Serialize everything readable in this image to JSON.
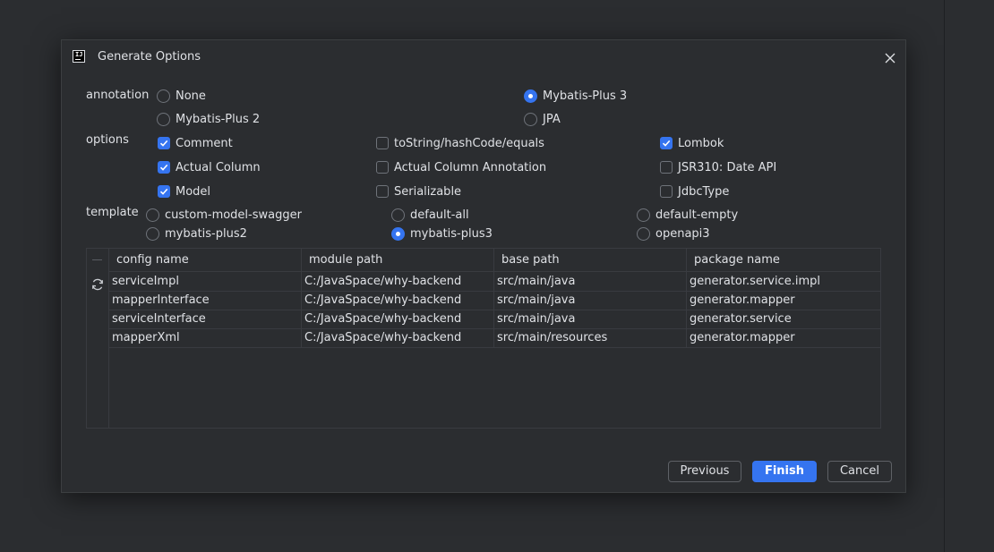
{
  "dialog": {
    "title": "Generate Options"
  },
  "annotation": {
    "label": "annotation",
    "options": [
      {
        "label": "None",
        "selected": false
      },
      {
        "label": "Mybatis-Plus 3",
        "selected": true
      },
      {
        "label": "Mybatis-Plus 2",
        "selected": false
      },
      {
        "label": "JPA",
        "selected": false
      }
    ]
  },
  "options": {
    "label": "options",
    "items": [
      {
        "label": "Comment",
        "checked": true
      },
      {
        "label": "toString/hashCode/equals",
        "checked": false
      },
      {
        "label": "Lombok",
        "checked": true
      },
      {
        "label": "Actual Column",
        "checked": true
      },
      {
        "label": "Actual Column Annotation",
        "checked": false
      },
      {
        "label": "JSR310: Date API",
        "checked": false
      },
      {
        "label": "Model",
        "checked": true
      },
      {
        "label": "Serializable",
        "checked": false
      },
      {
        "label": "JdbcType",
        "checked": false
      }
    ]
  },
  "template": {
    "label": "template",
    "options": [
      {
        "label": "custom-model-swagger",
        "selected": false
      },
      {
        "label": "default-all",
        "selected": false
      },
      {
        "label": "default-empty",
        "selected": false
      },
      {
        "label": "mybatis-plus2",
        "selected": false
      },
      {
        "label": "mybatis-plus3",
        "selected": true
      },
      {
        "label": "openapi3",
        "selected": false
      }
    ]
  },
  "table": {
    "columns": [
      "config name",
      "module path",
      "base path",
      "package name"
    ],
    "rows": [
      [
        "serviceImpl",
        "C:/JavaSpace/why-backend",
        "src/main/java",
        "generator.service.impl"
      ],
      [
        "mapperInterface",
        "C:/JavaSpace/why-backend",
        "src/main/java",
        "generator.mapper"
      ],
      [
        "serviceInterface",
        "C:/JavaSpace/why-backend",
        "src/main/java",
        "generator.service"
      ],
      [
        "mapperXml",
        "C:/JavaSpace/why-backend",
        "src/main/resources",
        "generator.mapper"
      ]
    ]
  },
  "buttons": {
    "previous": "Previous",
    "finish": "Finish",
    "cancel": "Cancel"
  },
  "colors": {
    "accent": "#3574f0",
    "background": "#2b2d30",
    "text": "#dfe1e5"
  }
}
